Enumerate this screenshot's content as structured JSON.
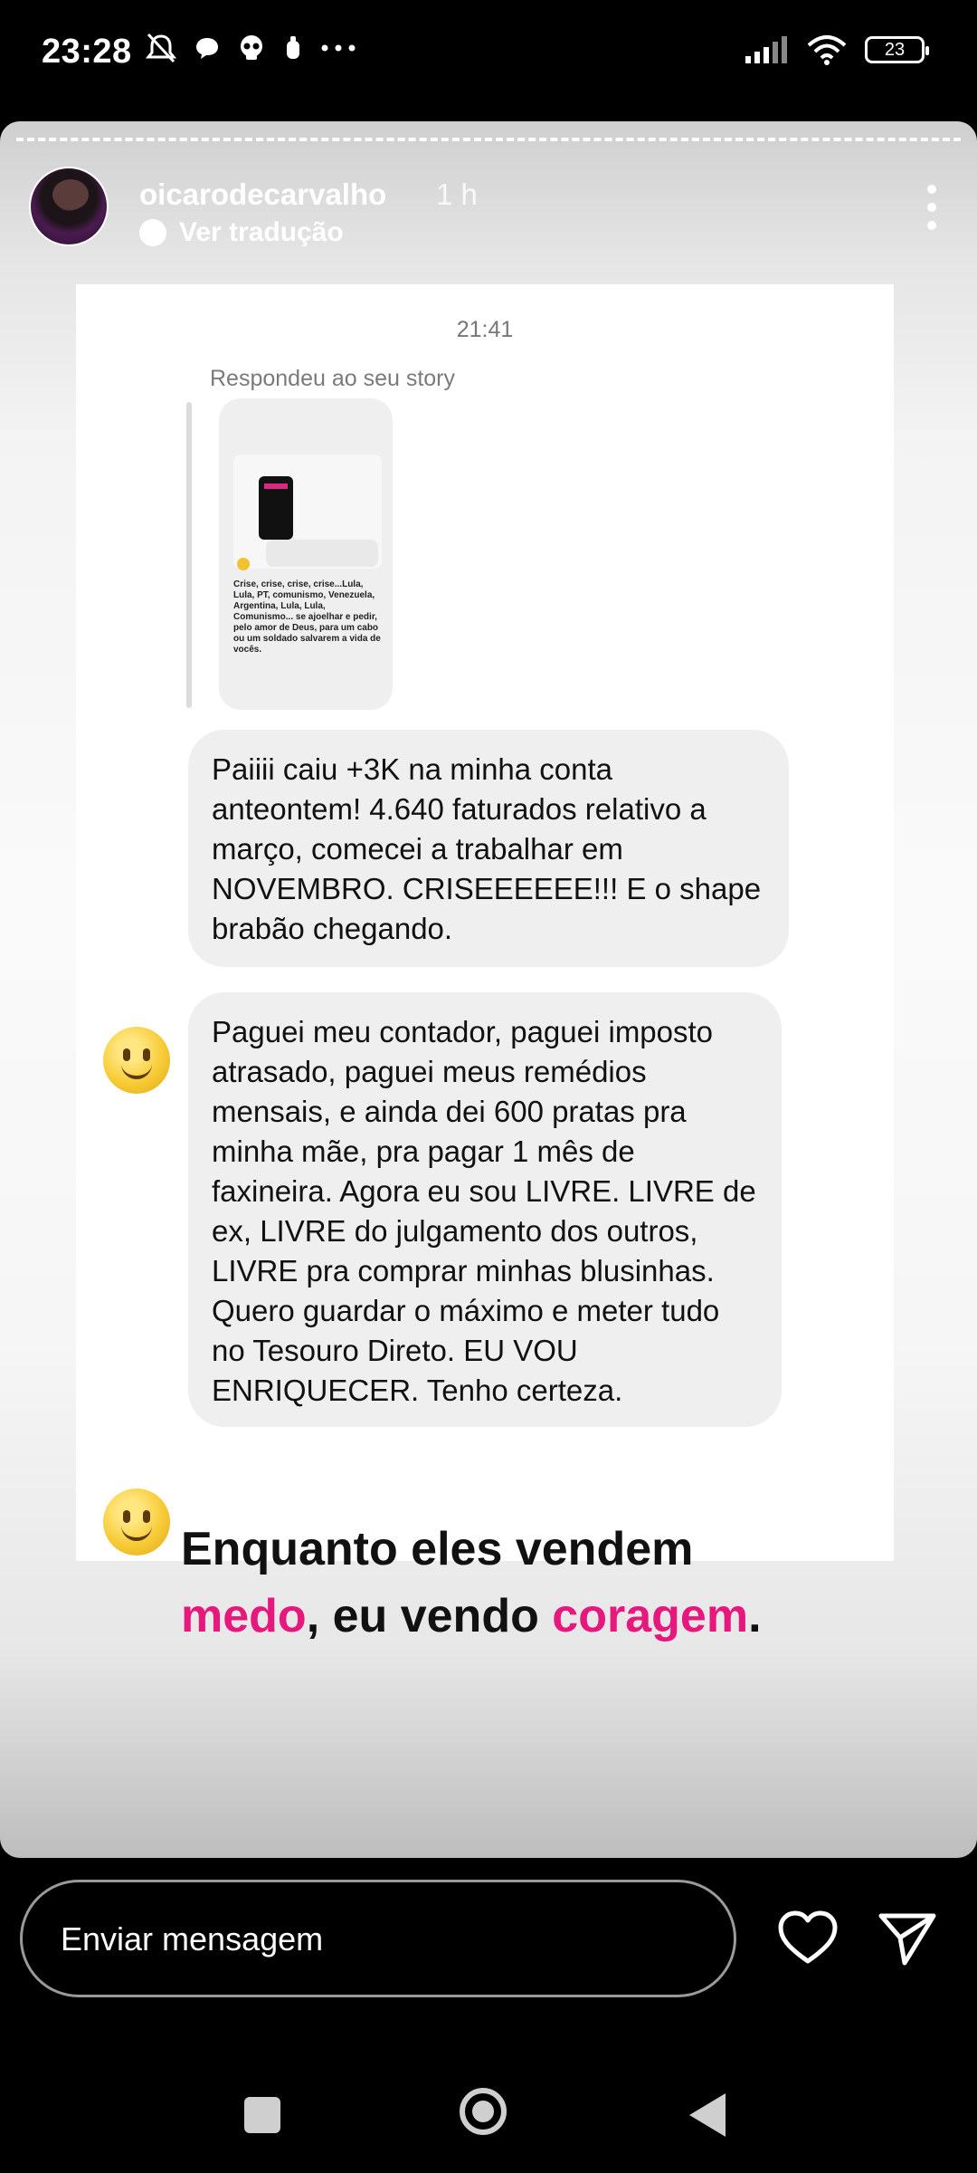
{
  "status_bar": {
    "time": "23:28",
    "battery": "23"
  },
  "story": {
    "username": "oicarodecarvalho",
    "time_ago": "1 h",
    "translate_label": "Ver tradução"
  },
  "chat": {
    "timestamp": "21:41",
    "replied_label": "Respondeu ao seu story",
    "thumbnail_text": "Crise, crise, crise, crise...Lula, Lula, PT, comunismo, Venezuela, Argentina, Lula, Lula, Comunismo... se ajoelhar e pedir, pelo amor de Deus, para um cabo ou um soldado salvarem a vida de vocês.",
    "messages": [
      {
        "text": "Paiiii caiu +3K na minha conta anteontem! 4.640 faturados relativo a março, comecei a trabalhar em NOVEMBRO. CRISEEEEEE!!! E o shape brabão chegando."
      },
      {
        "text": "Paguei meu contador, paguei imposto atrasado, paguei meus remédios mensais, e ainda dei 600 pratas pra minha mãe, pra pagar 1 mês de faxineira. Agora eu sou LIVRE. LIVRE de ex, LIVRE do julgamento dos outros, LIVRE pra comprar minhas blusinhas. Quero guardar o máximo e meter tudo no Tesouro Direto. EU VOU ENRIQUECER. Tenho certeza."
      }
    ]
  },
  "caption": {
    "line1": "Enquanto eles vendem",
    "word_fear": "medo",
    "middle": ", eu vendo ",
    "word_courage": "coragem",
    "end": "."
  },
  "message_bar": {
    "placeholder": "Enviar mensagem"
  },
  "colors": {
    "accent_pink": "#e6177d",
    "bubble_bg": "#efefef"
  },
  "icons": [
    "mute-icon",
    "chat-icon",
    "skull-icon",
    "notification-icon",
    "signal-icon",
    "wifi-icon",
    "heart-icon",
    "send-icon"
  ]
}
